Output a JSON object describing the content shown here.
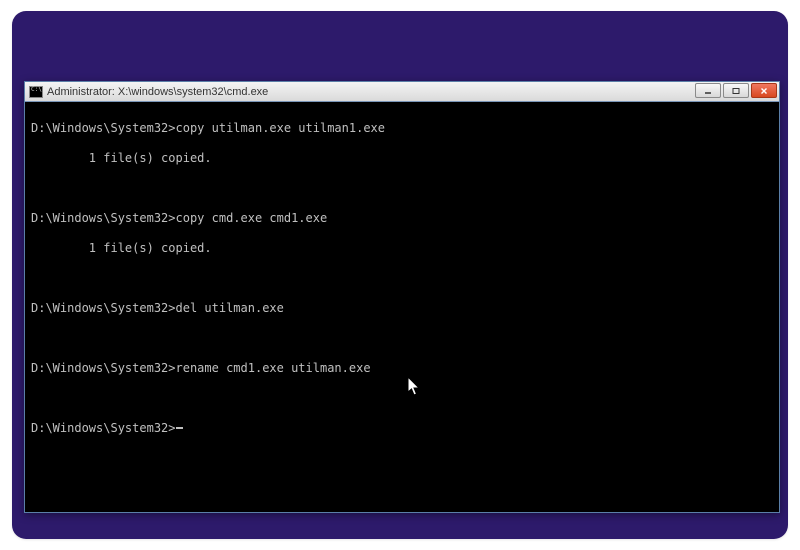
{
  "window": {
    "title": "Administrator: X:\\windows\\system32\\cmd.exe"
  },
  "terminal": {
    "prompt": "D:\\Windows\\System32>",
    "blank": " ",
    "lines": [
      {
        "text": "D:\\Windows\\System32>copy utilman.exe utilman1.exe"
      },
      {
        "text": "        1 file(s) copied."
      },
      {
        "text": " "
      },
      {
        "text": "D:\\Windows\\System32>copy cmd.exe cmd1.exe"
      },
      {
        "text": "        1 file(s) copied."
      },
      {
        "text": " "
      },
      {
        "text": "D:\\Windows\\System32>del utilman.exe"
      },
      {
        "text": " "
      },
      {
        "text": "D:\\Windows\\System32>rename cmd1.exe utilman.exe"
      },
      {
        "text": " "
      }
    ]
  }
}
